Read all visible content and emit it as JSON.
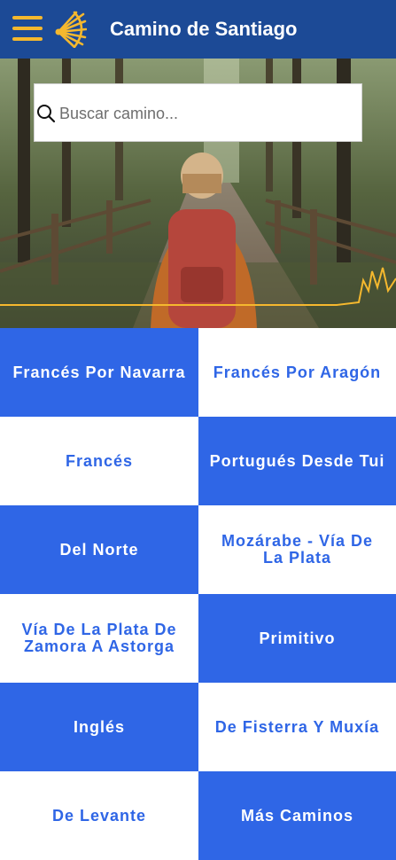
{
  "header": {
    "title": "Camino de Santiago",
    "menu_icon": "hamburger-menu-icon",
    "logo_icon": "scallop-shell-icon"
  },
  "search": {
    "placeholder": "Buscar camino...",
    "value": ""
  },
  "routes": [
    {
      "label": "Francés Por Navarra",
      "style": "blue"
    },
    {
      "label": "Francés Por Aragón",
      "style": "white"
    },
    {
      "label": "Francés",
      "style": "white"
    },
    {
      "label": "Portugués Desde Tui",
      "style": "blue"
    },
    {
      "label": "Del Norte",
      "style": "blue"
    },
    {
      "label": "Mozárabe - Vía De La Plata",
      "style": "white"
    },
    {
      "label": "Vía De La Plata De Zamora A Astorga",
      "style": "white"
    },
    {
      "label": "Primitivo",
      "style": "blue"
    },
    {
      "label": "Inglés",
      "style": "blue"
    },
    {
      "label": "De Fisterra Y Muxía",
      "style": "white"
    },
    {
      "label": "De Levante",
      "style": "white"
    },
    {
      "label": "Más Caminos",
      "style": "blue"
    }
  ],
  "colors": {
    "header": "#1c4a96",
    "accent": "#f5b82e",
    "tile_blue": "#2f66e6",
    "tile_white": "#ffffff"
  }
}
